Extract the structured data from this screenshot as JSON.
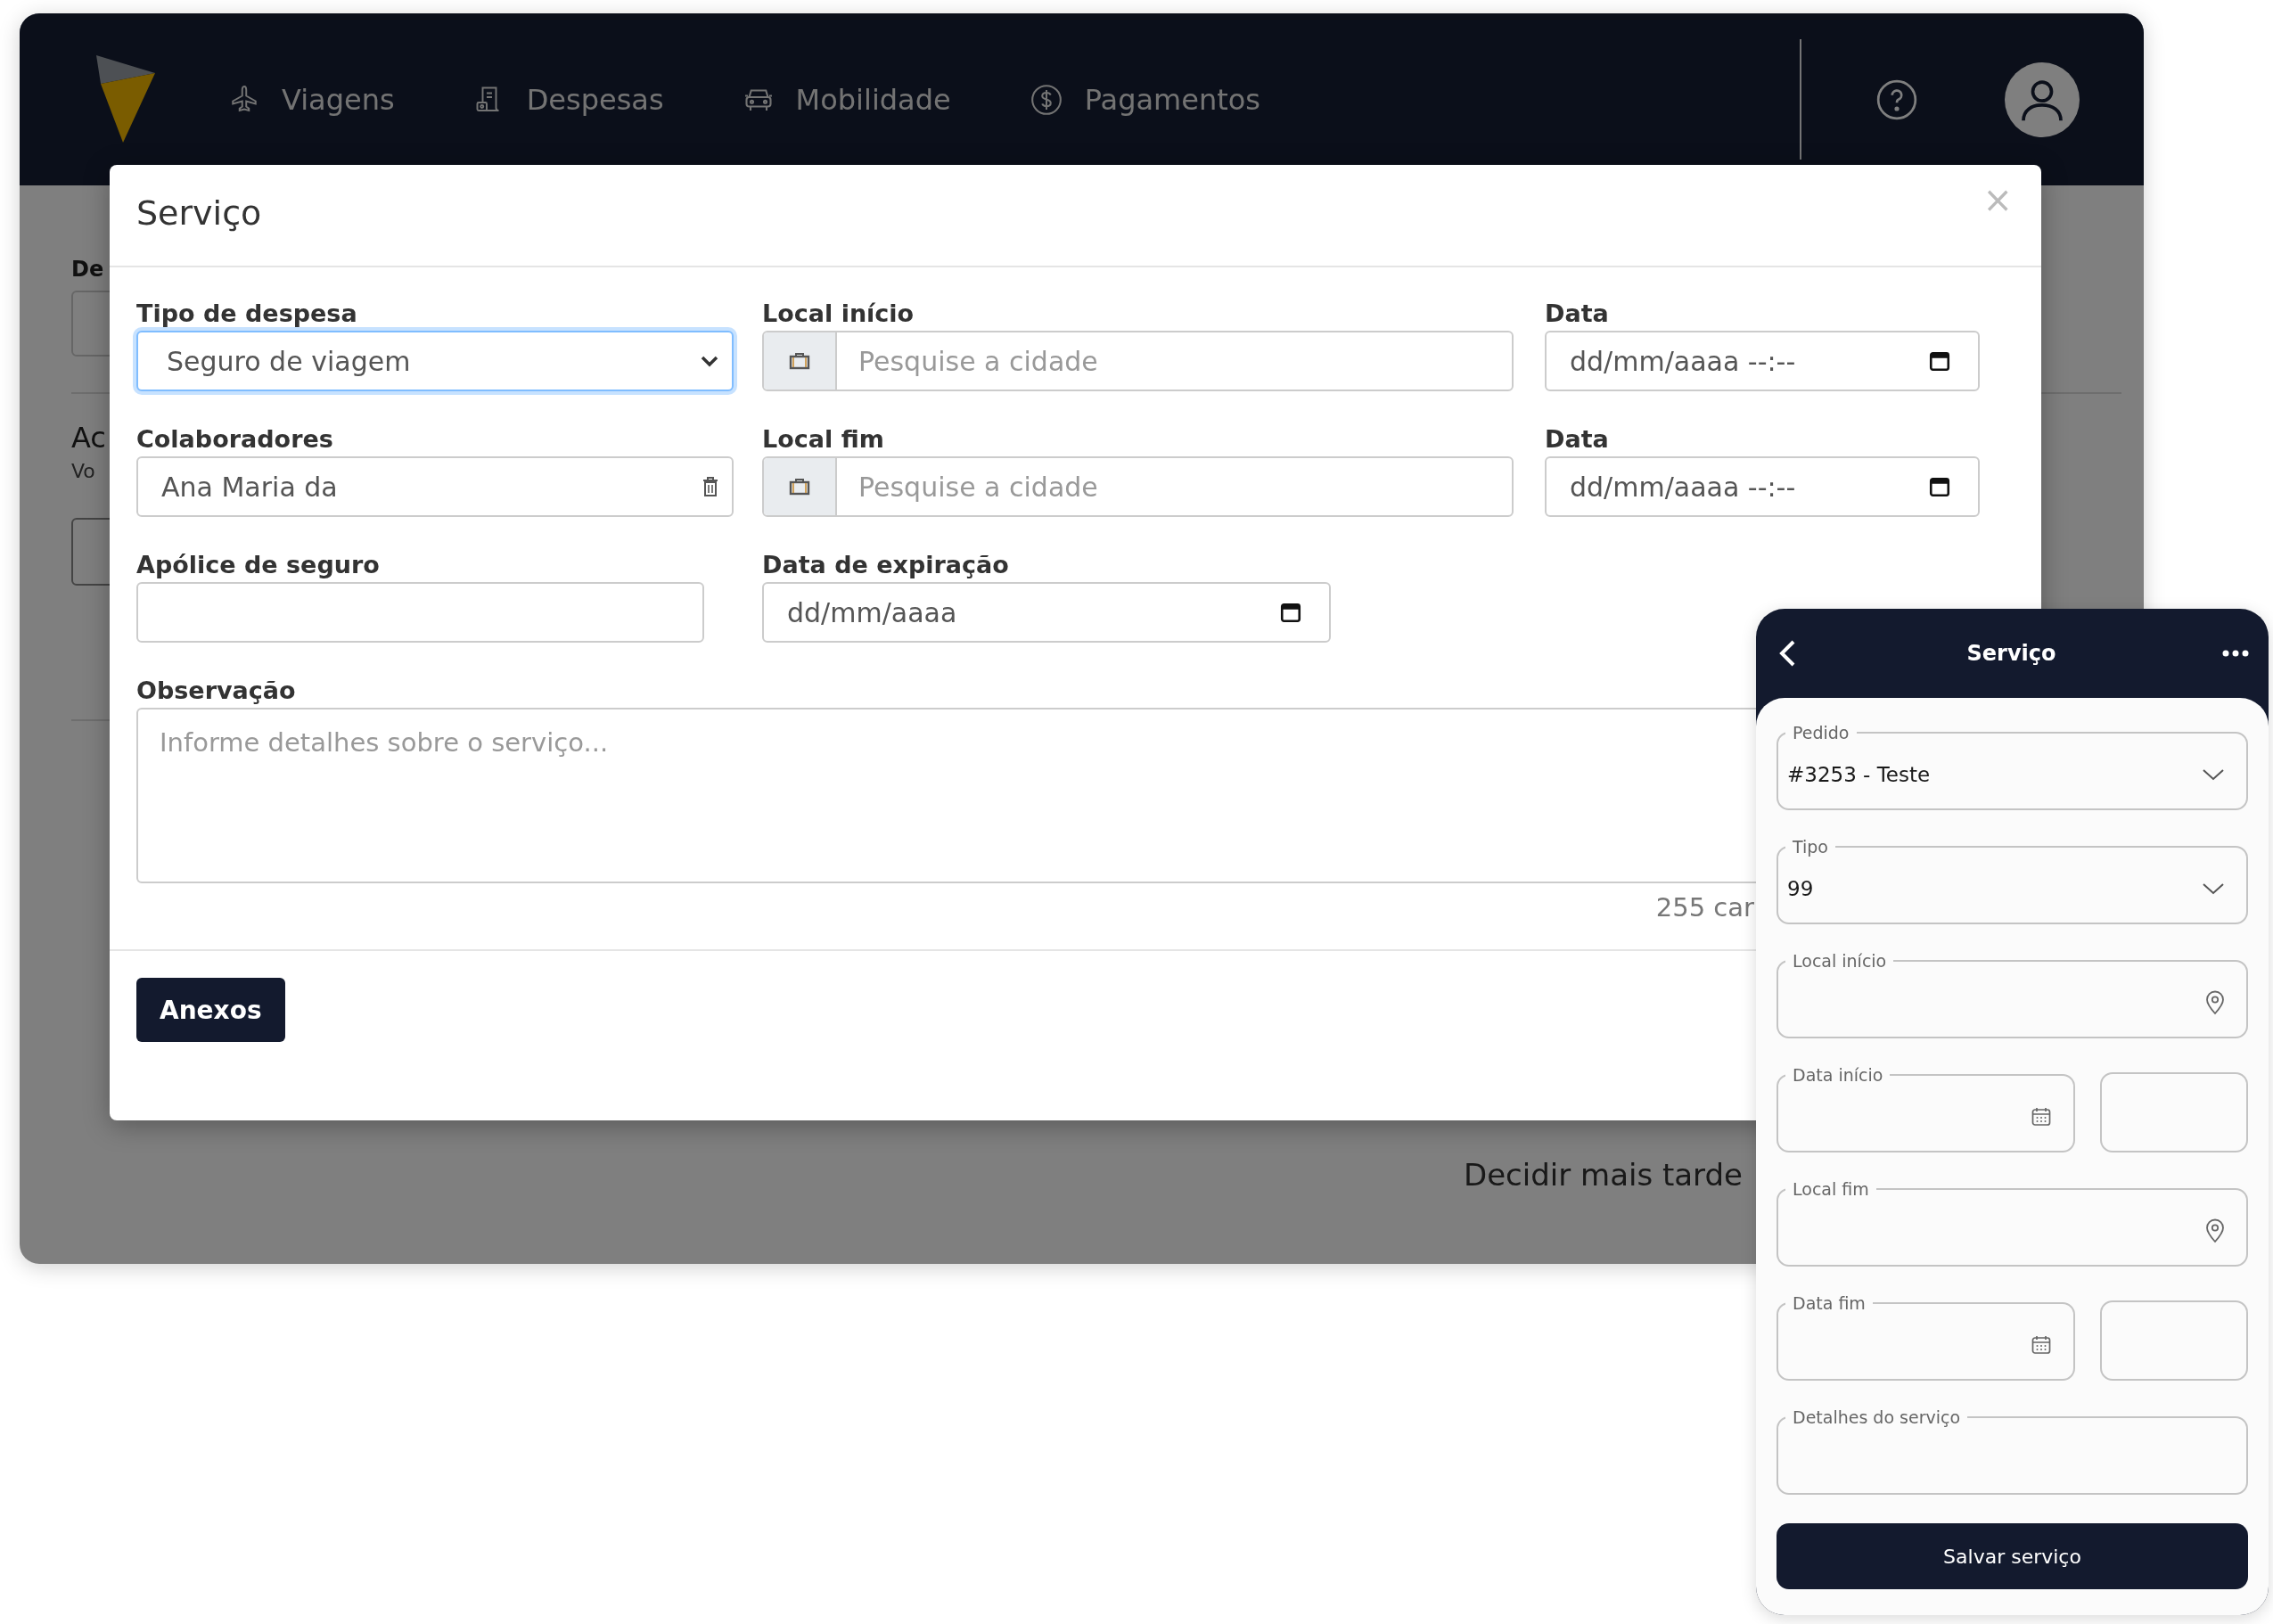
{
  "app": {
    "nav": [
      {
        "label": "Viagens"
      },
      {
        "label": "Despesas"
      },
      {
        "label": "Mobilidade"
      },
      {
        "label": "Pagamentos"
      }
    ],
    "background_page": {
      "section_label": "De",
      "heading": "Ac",
      "subtext": "Vo",
      "link": "Decidir mais tarde"
    }
  },
  "modal": {
    "title": "Serviço",
    "close": "×",
    "rows": [
      {
        "fields": [
          {
            "kind": "select",
            "label": "Tipo de despesa",
            "value": "Seguro de viagem",
            "focused": true
          },
          {
            "kind": "addon",
            "label": "Local início",
            "placeholder": "Pesquise a cidade",
            "focused": false
          },
          {
            "kind": "date",
            "label": "Data",
            "placeholder": "dd/mm/aaaa --:--",
            "focused": false
          }
        ]
      },
      {
        "fields": [
          {
            "kind": "tag",
            "label": "Colaboradores",
            "value": "Ana Maria da",
            "focused": false
          },
          {
            "kind": "addon",
            "label": "Local fim",
            "placeholder": "Pesquise a cidade",
            "focused": false
          },
          {
            "kind": "date",
            "label": "Data",
            "placeholder": "dd/mm/aaaa --:--",
            "focused": false
          }
        ]
      },
      {
        "fields": [
          {
            "kind": "text",
            "label": "Apólice de seguro",
            "focused": false
          },
          {
            "kind": "date",
            "label": "Data de expiração",
            "placeholder": "dd/mm/aaaa",
            "focused": false
          }
        ]
      }
    ],
    "observation": {
      "label": "Observação",
      "placeholder": "Informe detalhes sobre o serviço...",
      "counter": "255 car"
    },
    "attachments_button": "Anexos"
  },
  "mobile": {
    "title": "Serviço",
    "fields": [
      {
        "kind": "select",
        "label": "Pedido",
        "value": "#3253 - Teste"
      },
      {
        "kind": "select",
        "label": "Tipo",
        "value": "99"
      },
      {
        "kind": "location",
        "label": "Local início"
      },
      {
        "kind": "date",
        "label": "Data início"
      },
      {
        "kind": "location",
        "label": "Local fim"
      },
      {
        "kind": "date",
        "label": "Data fim"
      },
      {
        "kind": "textarea",
        "label": "Detalhes do serviço"
      }
    ],
    "save_button": "Salvar serviço"
  }
}
